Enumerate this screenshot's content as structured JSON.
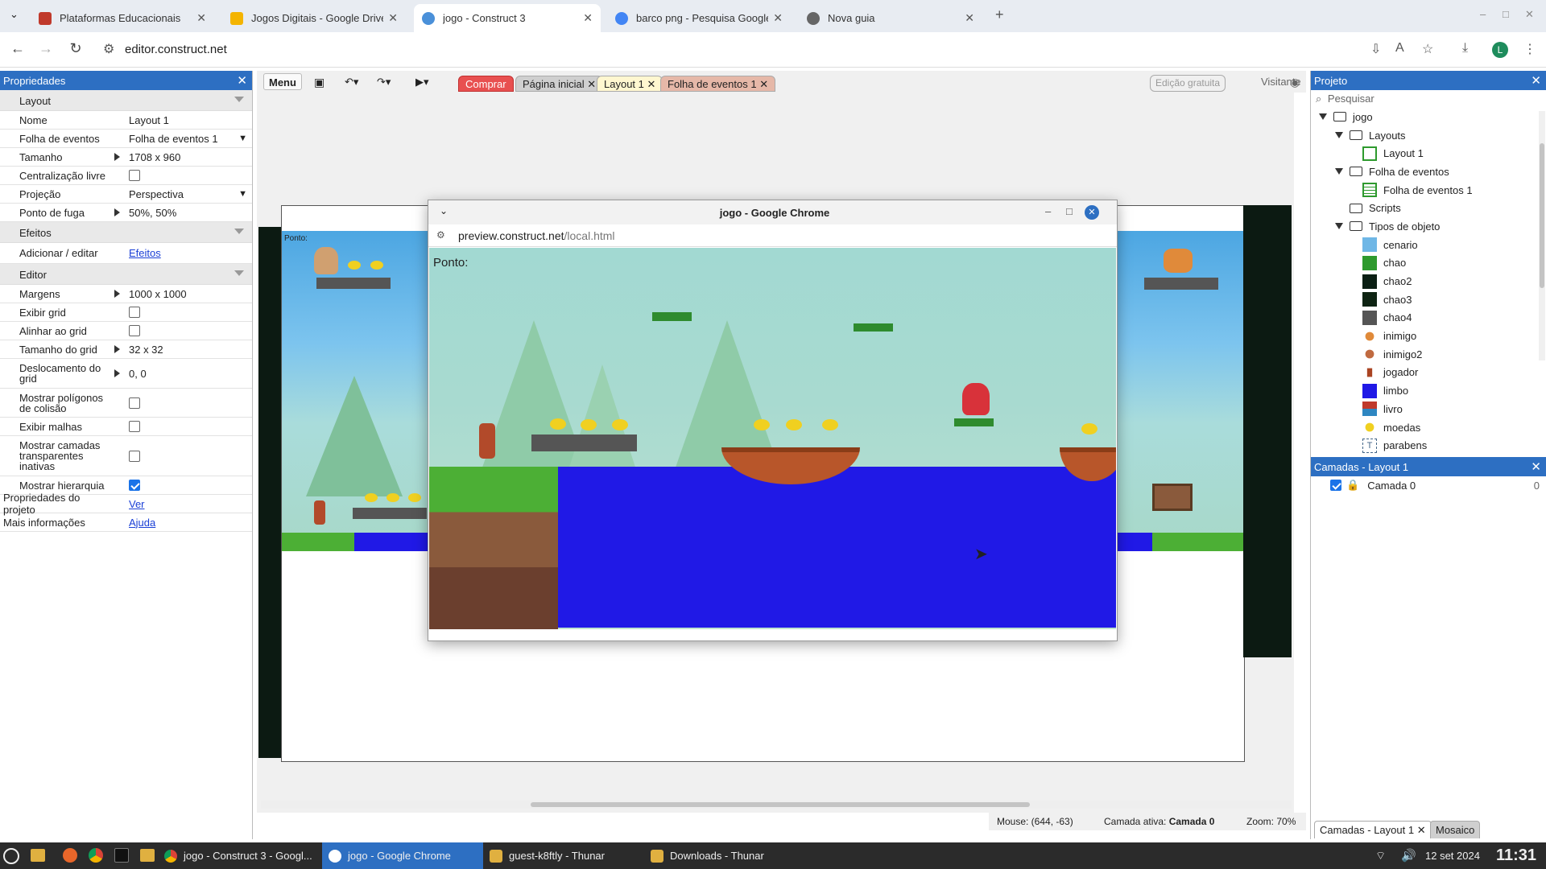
{
  "browser": {
    "tabs": [
      {
        "title": "Plataformas Educacionais",
        "color": "#c0392b"
      },
      {
        "title": "Jogos Digitais - Google Drive",
        "color": "#f4b400"
      },
      {
        "title": "jogo - Construct 3",
        "color": "#4a90d9"
      },
      {
        "title": "barco png - Pesquisa Google",
        "color": "#4285f4"
      },
      {
        "title": "Nova guia",
        "color": "#666666"
      }
    ],
    "url": "editor.construct.net",
    "profile_initial": "L"
  },
  "properties": {
    "title": "Propriedades",
    "sections": {
      "layout": "Layout",
      "efeitos": "Efeitos",
      "editor": "Editor"
    },
    "rows": {
      "nome": {
        "label": "Nome",
        "value": "Layout 1"
      },
      "folha": {
        "label": "Folha de eventos",
        "value": "Folha de eventos 1"
      },
      "tamanho": {
        "label": "Tamanho",
        "value": "1708 x 960"
      },
      "central": {
        "label": "Centralização livre"
      },
      "projecao": {
        "label": "Projeção",
        "value": "Perspectiva"
      },
      "fuga": {
        "label": "Ponto de fuga",
        "value": "50%, 50%"
      },
      "addeff": {
        "label": "Adicionar / editar",
        "value": "Efeitos"
      },
      "margens": {
        "label": "Margens",
        "value": "1000 x 1000"
      },
      "grid": {
        "label": "Exibir grid"
      },
      "alinhar": {
        "label": "Alinhar ao grid"
      },
      "tamgrid": {
        "label": "Tamanho do grid",
        "value": "32 x 32"
      },
      "desloc": {
        "label": "Deslocamento do grid",
        "value": "0, 0"
      },
      "poli": {
        "label": "Mostrar polígonos de colisão"
      },
      "malhas": {
        "label": "Exibir malhas"
      },
      "camadas": {
        "label": "Mostrar camadas transparentes inativas"
      },
      "hier": {
        "label": "Mostrar hierarquia"
      },
      "projprops": {
        "label": "Propriedades do projeto",
        "value": "Ver"
      },
      "info": {
        "label": "Mais informações",
        "value": "Ajuda"
      }
    }
  },
  "toolbar": {
    "menu": "Menu",
    "comprar": "Comprar",
    "tabs": [
      "Página inicial",
      "Layout 1",
      "Folha de eventos 1"
    ],
    "edicao": "Edição gratuita",
    "visitante": "Visitante"
  },
  "layout_canvas": {
    "ponto_label": "Ponto:"
  },
  "preview_window": {
    "title": "jogo - Google Chrome",
    "url_host": "preview.construct.net",
    "url_path": "/local.html",
    "ponto_label": "Ponto:"
  },
  "project": {
    "title": "Projeto",
    "search_placeholder": "Pesquisar",
    "root": "jogo",
    "layouts_folder": "Layouts",
    "layout_item": "Layout 1",
    "events_folder": "Folha de eventos",
    "event_item": "Folha de eventos 1",
    "scripts_folder": "Scripts",
    "types_folder": "Tipos de objeto",
    "objects": [
      {
        "name": "cenario",
        "color": "#6fb7e6"
      },
      {
        "name": "chao",
        "color": "#2e9a2e"
      },
      {
        "name": "chao2",
        "color": "#0b1f14"
      },
      {
        "name": "chao3",
        "color": "#0e2413"
      },
      {
        "name": "chao4",
        "color": "#555555"
      },
      {
        "name": "inimigo",
        "color": "#e08a3a"
      },
      {
        "name": "inimigo2",
        "color": "#c06a40"
      },
      {
        "name": "jogador",
        "color": "#aa4422"
      },
      {
        "name": "limbo",
        "color": "#2019e6"
      },
      {
        "name": "livro",
        "color": "#c0392b"
      },
      {
        "name": "moedas",
        "color": "#f0d020"
      },
      {
        "name": "parabens",
        "color": "#446688"
      }
    ]
  },
  "layers": {
    "title": "Camadas - Layout 1",
    "layer_name": "Camada 0",
    "layer_count": "0"
  },
  "bottom_tabs": [
    "Camadas - Layout 1",
    "Mosaico"
  ],
  "status": {
    "mouse": "Mouse: (644, -63)",
    "active_label": "Camada ativa:",
    "active_value": "Camada 0",
    "zoom": "Zoom: 70%"
  },
  "taskbar": {
    "items": [
      "jogo - Construct 3 - Googl...",
      "jogo - Google Chrome",
      "guest-k8ftly - Thunar",
      "Downloads - Thunar"
    ],
    "date": "12 set 2024",
    "time": "11:31"
  }
}
